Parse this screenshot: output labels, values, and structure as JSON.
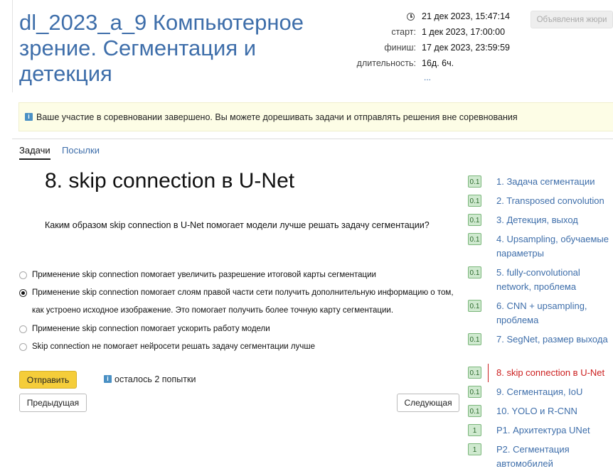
{
  "header": {
    "title": "dl_2023_a_9 Компьютерное зрение. Сегментация и детекция",
    "current_time": "21 дек 2023, 15:47:14",
    "start_label": "старт:",
    "start_value": "1 дек 2023, 17:00:00",
    "finish_label": "финиш:",
    "finish_value": "17 дек 2023, 23:59:59",
    "duration_label": "длительность:",
    "duration_value": "16д. 6ч.",
    "more": "...",
    "jury_button": "Объявления жюри"
  },
  "notice": {
    "text": "Ваше участие в соревновании завершено. Вы можете дорешивать задачи и отправлять решения вне соревнования"
  },
  "tabs": {
    "tasks": "Задачи",
    "submissions": "Посылки"
  },
  "problem": {
    "title": "8. skip connection в U-Net",
    "question": "Каким образом skip connection в U-Net помогает модели лучше решать задачу сегментации?",
    "options": [
      {
        "text": "Применение skip connection помогает увеличить разрешение итоговой карты сегментации",
        "checked": false
      },
      {
        "text": "Применение skip connection помогает слоям правой части сети получить дополнительную информацию о том, как устроено исходное изображение. Это помогает получить более точную карту сегментации.",
        "checked": true
      },
      {
        "text": "Применение skip connection помогает ускорить работу модели",
        "checked": false
      },
      {
        "text": "Skip connection не помогает нейросети решать задачу сегментации лучше",
        "checked": false
      }
    ],
    "submit": "Отправить",
    "attempts": "осталось 2 попытки",
    "prev": "Предыдущая",
    "next": "Следующая"
  },
  "problem_list": [
    {
      "score": "0.1",
      "label": "1. Задача сегментации"
    },
    {
      "score": "0.1",
      "label": "2. Transposed convolution"
    },
    {
      "score": "0.1",
      "label": "3. Детекция, выход"
    },
    {
      "score": "0.1",
      "label": "4. Upsampling, обучаемые параметры"
    },
    {
      "score": "0.1",
      "label": "5. fully-convolutional network, проблема"
    },
    {
      "score": "0.1",
      "label": "6. CNN + upsampling, проблема"
    },
    {
      "score": "0.1",
      "label": "7. SegNet, размер выхода"
    },
    {
      "score": "0.1",
      "label": "8. skip connection в U-Net",
      "active": true
    },
    {
      "score": "0.1",
      "label": "9. Сегментация, IoU"
    },
    {
      "score": "0.1",
      "label": "10. YOLO и R-CNN"
    },
    {
      "score": "1",
      "label": "P1. Архитектура UNet"
    },
    {
      "score": "1",
      "label": "P2. Сегментация автомобилей"
    }
  ],
  "icons": {
    "info": "info-icon",
    "clock": "clock-icon"
  },
  "colors": {
    "link": "#3e6eaa",
    "active": "#cc2020",
    "submit": "#f5cd3a",
    "badge_bg": "#cfe9cf"
  }
}
